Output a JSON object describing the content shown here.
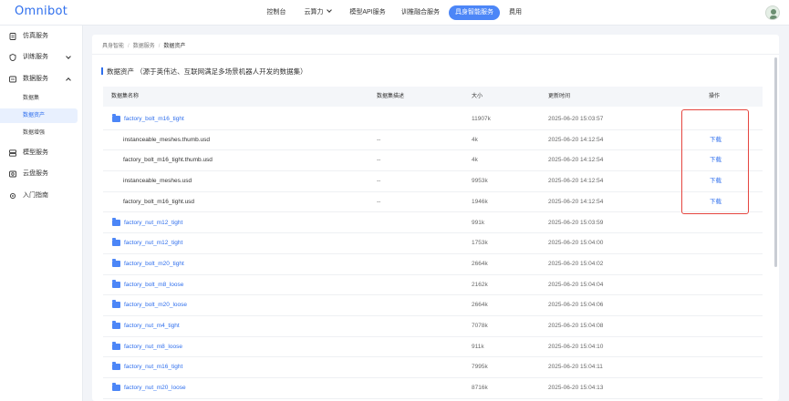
{
  "app": {
    "logo": "Omnibot"
  },
  "topnav": {
    "items": [
      {
        "label": "控制台"
      },
      {
        "label": "云算力"
      },
      {
        "label": "模型API服务"
      },
      {
        "label": "训推融合服务"
      },
      {
        "label": "具身智能服务"
      },
      {
        "label": "费用"
      }
    ]
  },
  "sidebar": {
    "items": [
      {
        "label": "仿真服务"
      },
      {
        "label": "训练服务"
      },
      {
        "label": "数据服务"
      },
      {
        "label": "模型服务"
      },
      {
        "label": "云盘服务"
      },
      {
        "label": "入门指南"
      }
    ],
    "sub": [
      {
        "label": "数据集"
      },
      {
        "label": "数据资产"
      },
      {
        "label": "数据增强"
      }
    ]
  },
  "breadcrumb": [
    "具身智能",
    "数据服务",
    "数据资产"
  ],
  "section": {
    "title": "数据资产 （源于英伟达、互联网满足多场景机器人开发的数据集）"
  },
  "table": {
    "headers": [
      "数据集名称",
      "数据集描述",
      "大小",
      "更新时间",
      "操作"
    ],
    "rows": [
      {
        "name": "factory_bolt_m16_tight",
        "desc": "",
        "size": "11907k",
        "time": "2025-06-20 15:03:57",
        "action": "",
        "folder": true
      },
      {
        "name": "instanceable_meshes.thumb.usd",
        "desc": "--",
        "size": "4k",
        "time": "2025-06-20 14:12:54",
        "action": "下载",
        "folder": false
      },
      {
        "name": "factory_bolt_m16_tight.thumb.usd",
        "desc": "--",
        "size": "4k",
        "time": "2025-06-20 14:12:54",
        "action": "下载",
        "folder": false
      },
      {
        "name": "instanceable_meshes.usd",
        "desc": "--",
        "size": "9953k",
        "time": "2025-06-20 14:12:54",
        "action": "下载",
        "folder": false
      },
      {
        "name": "factory_bolt_m16_tight.usd",
        "desc": "--",
        "size": "1946k",
        "time": "2025-06-20 14:12:54",
        "action": "下载",
        "folder": false
      },
      {
        "name": "factory_nut_m12_tight",
        "desc": "",
        "size": "991k",
        "time": "2025-06-20 15:03:59",
        "action": "",
        "folder": true
      },
      {
        "name": "factory_nut_m12_tight",
        "desc": "",
        "size": "1753k",
        "time": "2025-06-20 15:04:00",
        "action": "",
        "folder": true
      },
      {
        "name": "factory_bolt_m20_tight",
        "desc": "",
        "size": "2664k",
        "time": "2025-06-20 15:04:02",
        "action": "",
        "folder": true
      },
      {
        "name": "factory_bolt_m8_loose",
        "desc": "",
        "size": "2162k",
        "time": "2025-06-20 15:04:04",
        "action": "",
        "folder": true
      },
      {
        "name": "factory_bolt_m20_loose",
        "desc": "",
        "size": "2664k",
        "time": "2025-06-20 15:04:06",
        "action": "",
        "folder": true
      },
      {
        "name": "factory_nut_m4_tight",
        "desc": "",
        "size": "7078k",
        "time": "2025-06-20 15:04:08",
        "action": "",
        "folder": true
      },
      {
        "name": "factory_nut_m8_loose",
        "desc": "",
        "size": "911k",
        "time": "2025-06-20 15:04:10",
        "action": "",
        "folder": true
      },
      {
        "name": "factory_nut_m16_tight",
        "desc": "",
        "size": "7995k",
        "time": "2025-06-20 15:04:11",
        "action": "",
        "folder": true
      },
      {
        "name": "factory_nut_m20_loose",
        "desc": "",
        "size": "8716k",
        "time": "2025-06-20 15:04:13",
        "action": "",
        "folder": true
      }
    ]
  },
  "colors": {
    "accent": "#2f6fed",
    "highlight": "#e5453f"
  }
}
